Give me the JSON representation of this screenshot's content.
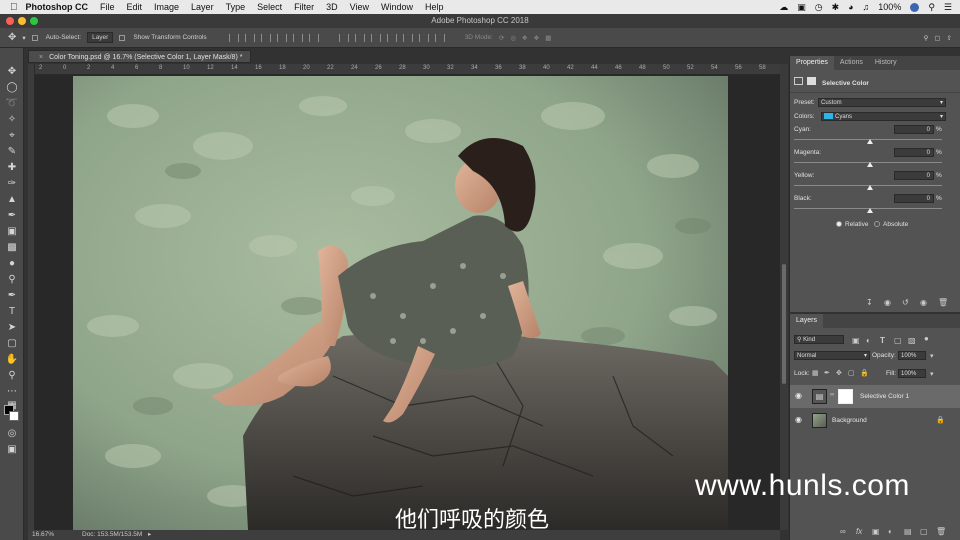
{
  "mac_menu": {
    "apple_icon": "apple-icon",
    "app_name": "Photoshop CC",
    "items": [
      "File",
      "Edit",
      "Image",
      "Layer",
      "Type",
      "Select",
      "Filter",
      "3D",
      "View",
      "Window",
      "Help"
    ],
    "battery": "100%"
  },
  "window": {
    "title": "Adobe Photoshop CC 2018"
  },
  "options_bar": {
    "auto_select_label": "Auto-Select:",
    "auto_select_value": "Layer",
    "transform_controls_label": "Show Transform Controls",
    "mode_3d_label": "3D Mode:"
  },
  "document": {
    "tab_title": "Color Toning.psd @ 16.7% (Selective Color 1, Layer Mask/8) *",
    "ruler_ticks": [
      "2",
      "0",
      "2",
      "4",
      "6",
      "8",
      "10",
      "12",
      "14",
      "16",
      "18",
      "20",
      "22",
      "24",
      "26",
      "28",
      "30",
      "32",
      "34",
      "36",
      "38",
      "40",
      "42",
      "44",
      "46",
      "48",
      "50",
      "52",
      "54",
      "56",
      "58"
    ],
    "zoom": "16.67%",
    "doc_info": "Doc: 153.5M/153.5M"
  },
  "properties_panel": {
    "tabs": [
      "Properties",
      "Actions",
      "History"
    ],
    "header": "Selective Color",
    "preset_label": "Preset:",
    "preset_value": "Custom",
    "colors_label": "Colors:",
    "colors_value": "Cyans",
    "swatch_color": "#2fb4e8",
    "sliders": [
      {
        "label": "Cyan:",
        "value": "0",
        "unit": "%"
      },
      {
        "label": "Magenta:",
        "value": "0",
        "unit": "%"
      },
      {
        "label": "Yellow:",
        "value": "0",
        "unit": "%"
      },
      {
        "label": "Black:",
        "value": "0",
        "unit": "%"
      }
    ],
    "method_relative": "Relative",
    "method_absolute": "Absolute",
    "selected_method": "Relative"
  },
  "layers_panel": {
    "tab": "Layers",
    "filter_value": "Kind",
    "blend_mode": "Normal",
    "opacity_label": "Opacity:",
    "opacity_value": "100%",
    "lock_label": "Lock:",
    "fill_label": "Fill:",
    "fill_value": "100%",
    "layers": [
      {
        "name": "Selective Color 1",
        "selected": true
      },
      {
        "name": "Background",
        "selected": false
      }
    ]
  },
  "overlay": {
    "watermark": "www.hunls.com",
    "subtitle": "他们呼吸的颜色"
  }
}
